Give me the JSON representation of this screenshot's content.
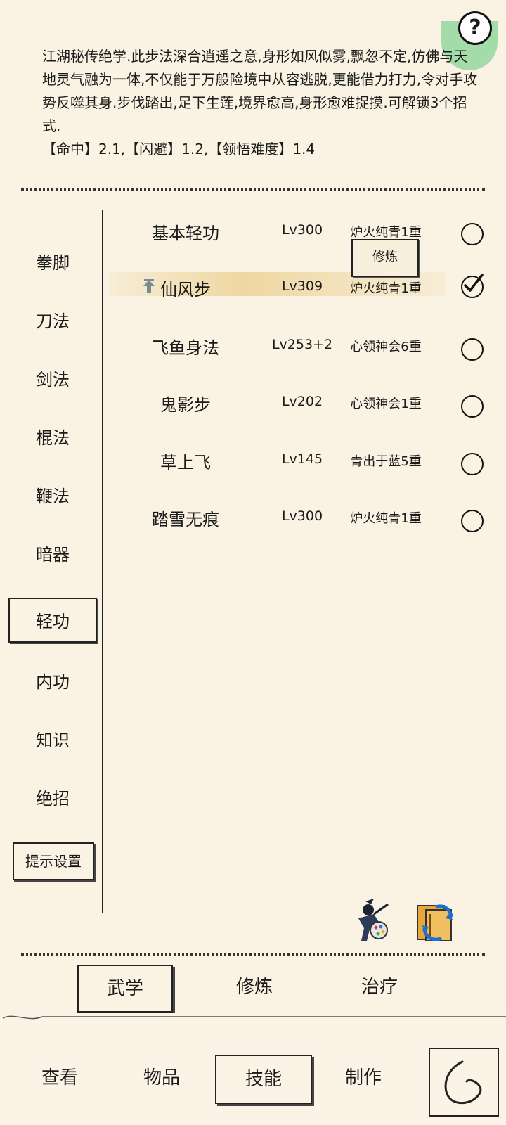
{
  "description": {
    "text": "江湖秘传绝学.此步法深合逍遥之意,身形如风似雾,飘忽不定,仿佛与天地灵气融为一体,不仅能于万般险境中从容逃脱,更能借力打力,令对手攻势反噬其身.步伐踏出,足下生莲,境界愈高,身形愈难捉摸.可解锁3个招式.",
    "stats": "【命中】2.1,【闪避】1.2,【领悟难度】1.4"
  },
  "help_icon": "?",
  "categories": [
    "拳脚",
    "刀法",
    "剑法",
    "棍法",
    "鞭法",
    "暗器",
    "轻功",
    "内功",
    "知识",
    "绝招"
  ],
  "active_category": "轻功",
  "tip_settings_label": "提示设置",
  "skills": [
    {
      "name": "基本轻功",
      "level": "Lv300",
      "realm": "炉火纯青1重",
      "checked": false
    },
    {
      "name": "仙风步",
      "level": "Lv309",
      "realm": "炉火纯青1重",
      "checked": true
    },
    {
      "name": "飞鱼身法",
      "level": "Lv253+2",
      "realm": "心领神会6重",
      "checked": false
    },
    {
      "name": "鬼影步",
      "level": "Lv202",
      "realm": "心领神会1重",
      "checked": false
    },
    {
      "name": "草上飞",
      "level": "Lv145",
      "realm": "青出于蓝5重",
      "checked": false
    },
    {
      "name": "踏雪无痕",
      "level": "Lv300",
      "realm": "炉火纯青1重",
      "checked": false
    }
  ],
  "practice_popup_label": "修炼",
  "sub_tabs": [
    "武学",
    "修炼",
    "治疗"
  ],
  "bottom_nav": [
    "查看",
    "物品",
    "技能",
    "制作"
  ],
  "icons": {
    "help": "question-icon",
    "upgrade": "up-arrow-icon",
    "checked": "checkmark-icon",
    "ninja": "ninja-palette-icon",
    "switch": "book-swap-icon",
    "back": "back-arrow-icon"
  }
}
